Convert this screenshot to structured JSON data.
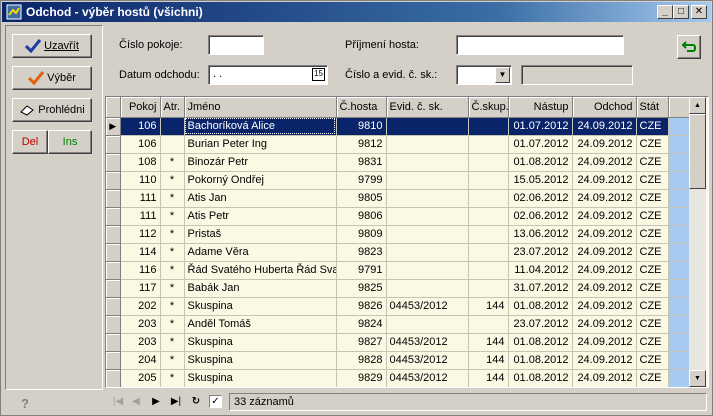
{
  "window": {
    "title": "Odchod - výběr hostů (všichni)",
    "minimize": "_",
    "maximize": "□",
    "close": "✕"
  },
  "left_buttons": {
    "close_label": "Uzavřít",
    "select_label": "Výběr",
    "view_label": "Prohlédni",
    "del_label": "Del",
    "ins_label": "Ins",
    "help": "?"
  },
  "filters": {
    "room_label": "Číslo pokoje:",
    "room_value": "",
    "departure_label": "Datum odchodu:",
    "departure_value": ". .",
    "calendar_icon_text": "15",
    "surname_label": "Příjmení hosta:",
    "surname_value": "",
    "record_label": "Číslo a evid. č. sk.:",
    "record_value": "",
    "record_extra_value": "",
    "combo_arrow": "▼"
  },
  "table": {
    "columns": [
      "Pokoj",
      "Atr.",
      "Jméno",
      "Č.hosta",
      "Evid. č. sk.",
      "Č.skup.",
      "Nástup",
      "Odchod",
      "Stát"
    ],
    "rows": [
      [
        "106",
        "",
        "Bachoríková Alice",
        "9810",
        "",
        "",
        "01.07.2012",
        "24.09.2012",
        "CZE"
      ],
      [
        "106",
        "",
        "Burian Peter Ing",
        "9812",
        "",
        "",
        "01.07.2012",
        "24.09.2012",
        "CZE"
      ],
      [
        "108",
        "*",
        "Binozár Petr",
        "9831",
        "",
        "",
        "01.08.2012",
        "24.09.2012",
        "CZE"
      ],
      [
        "110",
        "*",
        "Pokorný Ondřej",
        "9799",
        "",
        "",
        "15.05.2012",
        "24.09.2012",
        "CZE"
      ],
      [
        "111",
        "*",
        "Atis Jan",
        "9805",
        "",
        "",
        "02.06.2012",
        "24.09.2012",
        "CZE"
      ],
      [
        "111",
        "*",
        "Atis Petr",
        "9806",
        "",
        "",
        "02.06.2012",
        "24.09.2012",
        "CZE"
      ],
      [
        "112",
        "*",
        "Pristaš",
        "9809",
        "",
        "",
        "13.06.2012",
        "24.09.2012",
        "CZE"
      ],
      [
        "114",
        "*",
        "Adame Věra",
        "9823",
        "",
        "",
        "23.07.2012",
        "24.09.2012",
        "CZE"
      ],
      [
        "116",
        "*",
        "Řád Svatého Huberta Řád Sva",
        "9791",
        "",
        "",
        "11.04.2012",
        "24.09.2012",
        "CZE"
      ],
      [
        "117",
        "*",
        "Babák Jan",
        "9825",
        "",
        "",
        "31.07.2012",
        "24.09.2012",
        "CZE"
      ],
      [
        "202",
        "*",
        "Skuspina",
        "9826",
        "04453/2012",
        "144",
        "01.08.2012",
        "24.09.2012",
        "CZE"
      ],
      [
        "203",
        "*",
        "Anděl Tomáš",
        "9824",
        "",
        "",
        "23.07.2012",
        "24.09.2012",
        "CZE"
      ],
      [
        "203",
        "*",
        "Skuspina",
        "9827",
        "04453/2012",
        "144",
        "01.08.2012",
        "24.09.2012",
        "CZE"
      ],
      [
        "204",
        "*",
        "Skuspina",
        "9828",
        "04453/2012",
        "144",
        "01.08.2012",
        "24.09.2012",
        "CZE"
      ],
      [
        "205",
        "*",
        "Skuspina",
        "9829",
        "04453/2012",
        "144",
        "01.08.2012",
        "24.09.2012",
        "CZE"
      ]
    ],
    "current_row_marker": "▶"
  },
  "scrollbar": {
    "up": "▲",
    "down": "▼"
  },
  "status": {
    "first": "|◀",
    "prev": "◀",
    "next": "▶",
    "last": "▶|",
    "refresh": "↻",
    "check": "✓",
    "count": "33 záznamů"
  },
  "colors": {
    "titlebar_start": "#0a246a",
    "selection": "#0a246a",
    "grid_background": "#fbf8e4",
    "state_column": "#a6caf0"
  }
}
